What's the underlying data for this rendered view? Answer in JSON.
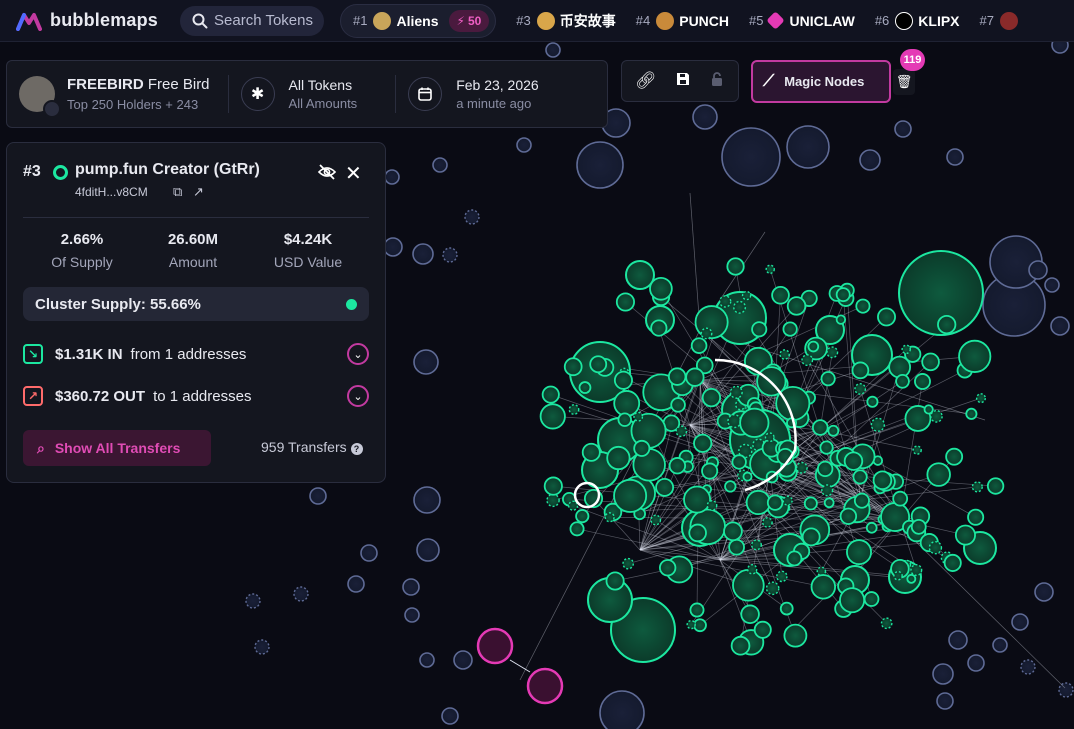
{
  "brand": {
    "name": "bubblemaps"
  },
  "search": {
    "placeholder": "Search Tokens"
  },
  "trending": [
    {
      "rank": "#1",
      "name": "Aliens",
      "count": "50",
      "icon_color": "#c9a55a"
    },
    {
      "rank": "#3",
      "name": "币安故事",
      "icon_color": "#d9a64a"
    },
    {
      "rank": "#4",
      "name": "PUNCH",
      "icon_color": "#c98a3a"
    },
    {
      "rank": "#5",
      "name": "UNICLAW",
      "icon_color": "#e43ab5"
    },
    {
      "rank": "#6",
      "name": "KLIPX",
      "icon_color": "#ffffff"
    },
    {
      "rank": "#7",
      "name": "",
      "icon_color": "#8a2a2a"
    }
  ],
  "token": {
    "symbol": "FREEBIRD",
    "name": "Free Bird",
    "holders": "Top 250 Holders + 243",
    "filter_title": "All Tokens",
    "filter_sub": "All Amounts",
    "date": "Feb 23, 2026",
    "updated": "a minute ago"
  },
  "toolbar": {
    "magic_label": "Magic Nodes",
    "magic_badge": "119",
    "icons": [
      "link-icon",
      "save-icon",
      "lock-icon",
      "trash-icon"
    ]
  },
  "holder": {
    "rank": "#3",
    "name": "pump.fun Creator (GtRr)",
    "address": "4fditH...v8CM",
    "supply_pct": "2.66%",
    "supply_label": "Of Supply",
    "amount": "26.60M",
    "amount_label": "Amount",
    "usd": "$4.24K",
    "usd_label": "USD Value",
    "cluster_supply": "Cluster Supply: 55.66%",
    "in_value": "$1.31K IN",
    "in_desc": "from 1 addresses",
    "out_value": "$360.72 OUT",
    "out_desc": "to 1 addresses",
    "show_transfers": "Show All Transfers",
    "transfers": "959 Transfers"
  },
  "colors": {
    "accent": "#c23aa0",
    "cluster_green": "#1ce7a0",
    "bubble_blue": "#5f6b96",
    "bg": "#0a0b14"
  }
}
